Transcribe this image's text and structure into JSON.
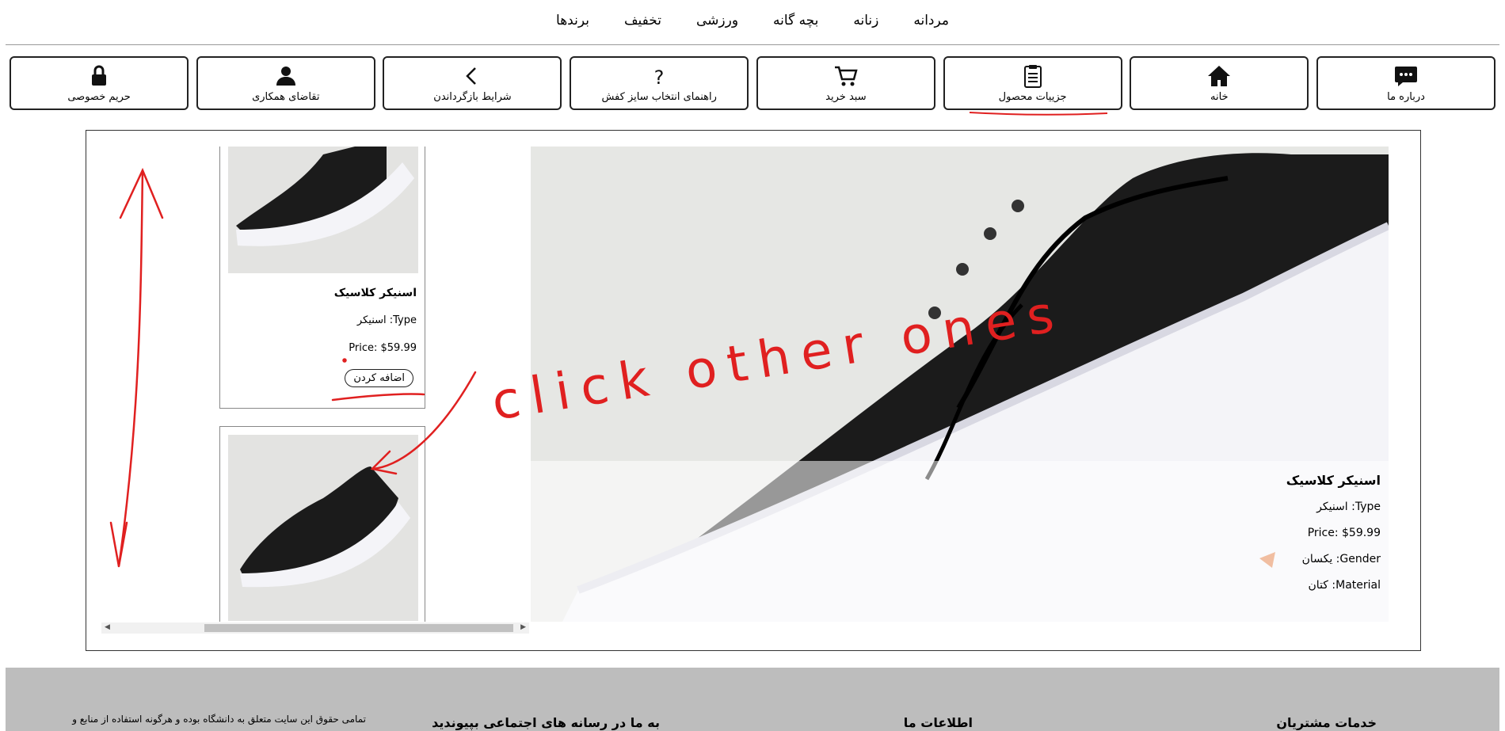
{
  "topnav": [
    "مردانه",
    "زنانه",
    "بچه گانه",
    "ورزشی",
    "تخفیف",
    "برندها"
  ],
  "iconnav": [
    {
      "label": "درباره ما",
      "icon": "chat-icon"
    },
    {
      "label": "خانه",
      "icon": "home-icon"
    },
    {
      "label": "جزییات محصول",
      "icon": "clipboard-icon"
    },
    {
      "label": "سبد خرید",
      "icon": "cart-icon"
    },
    {
      "label": "راهنمای انتخاب سایز کفش",
      "icon": "question-icon"
    },
    {
      "label": "شرایط بازگرداندن",
      "icon": "chevron-left-icon"
    },
    {
      "label": "تقاضای همکاری",
      "icon": "user-icon"
    },
    {
      "label": "حریم خصوصی",
      "icon": "lock-icon"
    }
  ],
  "hero": {
    "title": "اسنیکر کلاسیک",
    "type": "Type: اسنیکر",
    "price": "Price: $59.99",
    "gender": "Gender: یکسان",
    "material": "Material: کتان"
  },
  "cards": [
    {
      "title": "اسنیکر کلاسیک",
      "type": "Type: اسنیکر",
      "price": "Price: $59.99",
      "button": "اضافه کردن"
    }
  ],
  "annotation": {
    "text": "click other ones",
    "color": "#e02020"
  },
  "footer": {
    "customer_services": "خدمات مشتریان",
    "about_us": "اطلاعات ما",
    "social": "به ما در رسانه های اجتماعی بپیوندید",
    "copyright": "تمامی حقوق این سایت متعلق به دانشگاه بوده و هرگونه استفاده از منابع و"
  }
}
